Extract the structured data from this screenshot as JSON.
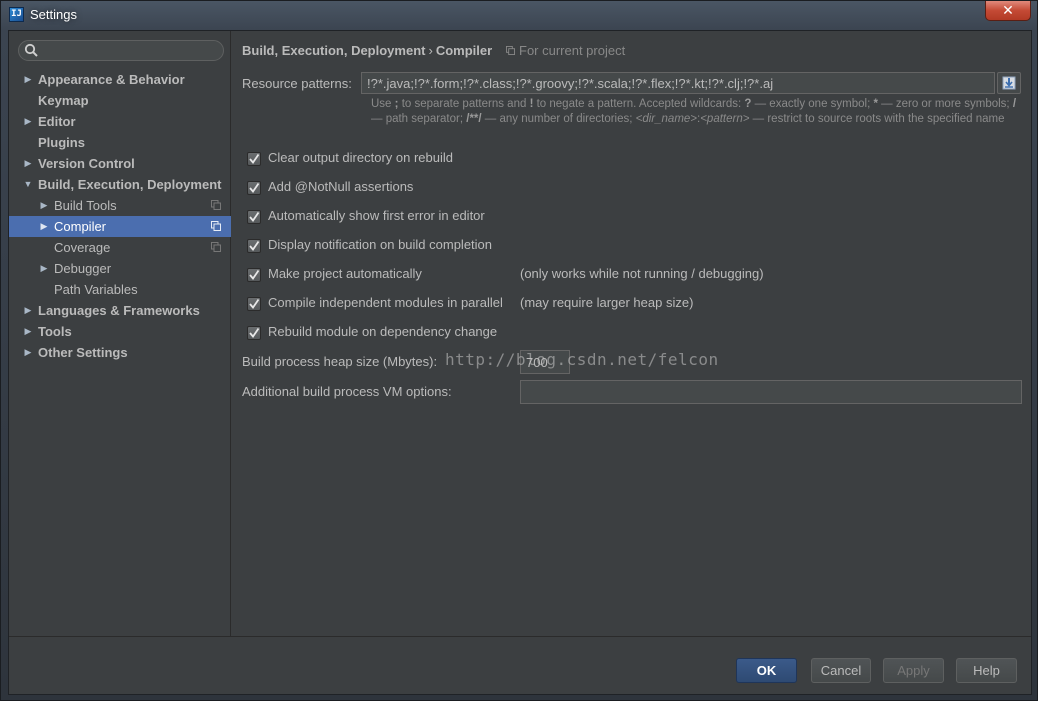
{
  "window": {
    "title": "Settings",
    "app_icon_letter": "IJ",
    "close_glyph": "✕"
  },
  "search": {
    "value": "",
    "placeholder": ""
  },
  "sidebar": {
    "items": [
      {
        "label": "Appearance & Behavior",
        "level": 0,
        "arrow": "▶"
      },
      {
        "label": "Keymap",
        "level": 0,
        "arrow": ""
      },
      {
        "label": "Editor",
        "level": 0,
        "arrow": "▶"
      },
      {
        "label": "Plugins",
        "level": 0,
        "arrow": ""
      },
      {
        "label": "Version Control",
        "level": 0,
        "arrow": "▶"
      },
      {
        "label": "Build, Execution, Deployment",
        "level": 0,
        "arrow": "▼"
      },
      {
        "label": "Build Tools",
        "level": 1,
        "arrow": "▶"
      },
      {
        "label": "Compiler",
        "level": 1,
        "arrow": "▶",
        "selected": true
      },
      {
        "label": "Coverage",
        "level": 1,
        "arrow": ""
      },
      {
        "label": "Debugger",
        "level": 1,
        "arrow": "▶"
      },
      {
        "label": "Path Variables",
        "level": 1,
        "arrow": ""
      },
      {
        "label": "Languages & Frameworks",
        "level": 0,
        "arrow": "▶"
      },
      {
        "label": "Tools",
        "level": 0,
        "arrow": "▶"
      },
      {
        "label": "Other Settings",
        "level": 0,
        "arrow": "▶"
      }
    ]
  },
  "breadcrumb": {
    "parent": "Build, Execution, Deployment",
    "separator": "›",
    "current": "Compiler",
    "scope": "For current project"
  },
  "resource": {
    "label": "Resource patterns:",
    "value": "!?*.java;!?*.form;!?*.class;!?*.groovy;!?*.scala;!?*.flex;!?*.kt;!?*.clj;!?*.aj"
  },
  "hint": {
    "p1": "Use ",
    "k1": ";",
    "p2": " to separate patterns and ",
    "k2": "!",
    "p3": " to negate a pattern. Accepted wildcards: ",
    "k3": "?",
    "p4": " — exactly one symbol; ",
    "k4": "*",
    "p5": " — zero or more symbols; ",
    "k5": "/",
    "p6": " — path separator; ",
    "k6": "/**/",
    "p7": " — any number of directories; ",
    "i1": "<dir_name>",
    "p8": ":",
    "i2": "<pattern>",
    "p9": " — restrict to source roots with the specified name"
  },
  "options": [
    {
      "label": "Clear output directory on rebuild",
      "checked": true,
      "note": ""
    },
    {
      "label": "Add @NotNull assertions",
      "checked": true,
      "note": ""
    },
    {
      "label": "Automatically show first error in editor",
      "checked": true,
      "note": ""
    },
    {
      "label": "Display notification on build completion",
      "checked": true,
      "note": ""
    },
    {
      "label": "Make project automatically",
      "checked": true,
      "note": "(only works while not running / debugging)"
    },
    {
      "label": "Compile independent modules in parallel",
      "checked": true,
      "note": "(may require larger heap size)"
    },
    {
      "label": "Rebuild module on dependency change",
      "checked": true,
      "note": ""
    }
  ],
  "heap": {
    "label": "Build process heap size (Mbytes):",
    "value": "700"
  },
  "vm": {
    "label": "Additional build process VM options:",
    "value": ""
  },
  "watermark": "http://blog.csdn.net/felcon",
  "buttons": {
    "ok": "OK",
    "cancel": "Cancel",
    "apply": "Apply",
    "help": "Help"
  },
  "colors": {
    "background": "#3c3f41",
    "selection": "#4b6eaf",
    "text": "#bbbbbb",
    "close": "#c44a35"
  }
}
